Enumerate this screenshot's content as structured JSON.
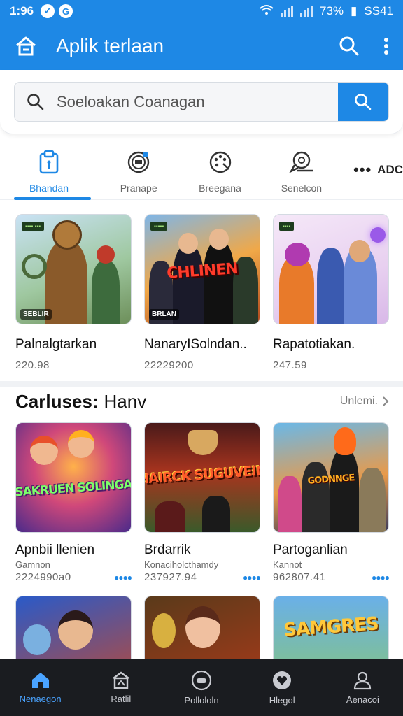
{
  "status": {
    "time": "1:96",
    "battery": "73%",
    "carrier": "SS41"
  },
  "appbar": {
    "title": "Aplik terlaan"
  },
  "search": {
    "placeholder": "Soeloakan Coanagan"
  },
  "categories": [
    {
      "label": "Bhandan",
      "active": true,
      "icon": "clipboard-icon"
    },
    {
      "label": "Pranape",
      "active": false,
      "icon": "compass-icon"
    },
    {
      "label": "Breegana",
      "active": false,
      "icon": "palette-icon"
    },
    {
      "label": "Senelcon",
      "active": false,
      "icon": "chat-icon"
    }
  ],
  "categories_more": "ADC",
  "featured": [
    {
      "title": "Palnalgtarkan",
      "value": "220.98",
      "tag": "SEBLIR",
      "thumb_tag": "▪▪▪▪ ▪▪▪"
    },
    {
      "title": "NanaryISolndan..",
      "value": "22229200",
      "tag": "BRLAN",
      "banner": "CHLINEN",
      "thumb_tag": "▪▪▪▪▪"
    },
    {
      "title": "Rapatotiakan.",
      "value": "247.59",
      "tag": "",
      "thumb_tag": "▪▪▪▪"
    }
  ],
  "section": {
    "title": "Carluses:",
    "subtitle": "Hanv",
    "link": "Unlemi."
  },
  "popular": [
    {
      "title": "Apnbii llenien",
      "subtitle": "Gamnon",
      "value": "2224990a0",
      "banner": "SAKRUEN SOLINGA"
    },
    {
      "title": "Brdarrik",
      "subtitle": "Konaciholcthamdy",
      "value": "237927.94",
      "banner": "HAIRCK SUGUVEIN"
    },
    {
      "title": "Partoganlian",
      "subtitle": "Kannot",
      "value": "962807.41",
      "banner": "GODNNGE"
    }
  ],
  "next_row": [
    {
      "banner": ""
    },
    {
      "banner": ""
    },
    {
      "banner": "SAMGRES"
    }
  ],
  "nav": [
    {
      "label": "Nenaegon",
      "icon": "home-icon",
      "active": true
    },
    {
      "label": "Ratlil",
      "icon": "store-icon",
      "active": false
    },
    {
      "label": "Pollololn",
      "icon": "game-controller-icon",
      "active": false
    },
    {
      "label": "Hlegol",
      "icon": "heart-icon",
      "active": false
    },
    {
      "label": "Aenacoi",
      "icon": "profile-icon",
      "active": false
    }
  ],
  "colors": {
    "primary": "#1e88e5",
    "navbar": "#1a1c20"
  }
}
